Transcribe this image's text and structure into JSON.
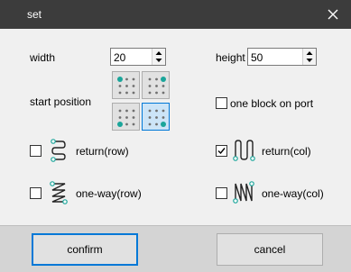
{
  "window": {
    "title": "set"
  },
  "width": {
    "label": "width",
    "value": "20"
  },
  "height": {
    "label": "height",
    "value": "50"
  },
  "start_position": {
    "label": "start position",
    "options": [
      {
        "corner": "top-left",
        "selected": false
      },
      {
        "corner": "top-right",
        "selected": false
      },
      {
        "corner": "bottom-left",
        "selected": false
      },
      {
        "corner": "bottom-right",
        "selected": true
      }
    ]
  },
  "one_block_on_port": {
    "label": "one block on port",
    "checked": false
  },
  "modes": {
    "return_row": {
      "label": "return(row)",
      "checked": false
    },
    "return_col": {
      "label": "return(col)",
      "checked": true
    },
    "oneway_row": {
      "label": "one-way(row)",
      "checked": false
    },
    "oneway_col": {
      "label": "one-way(col)",
      "checked": false
    }
  },
  "buttons": {
    "confirm": "confirm",
    "cancel": "cancel"
  },
  "colors": {
    "titlebar": "#3c3c3c",
    "accent": "#0078d7",
    "teal": "#1aa59a",
    "dot": "#707070"
  },
  "icons": [
    "close-icon",
    "spin-up-icon",
    "spin-down-icon",
    "corner-dot-grid-icon",
    "return-row-icon",
    "return-col-icon",
    "oneway-row-icon",
    "oneway-col-icon",
    "checkmark-icon"
  ]
}
